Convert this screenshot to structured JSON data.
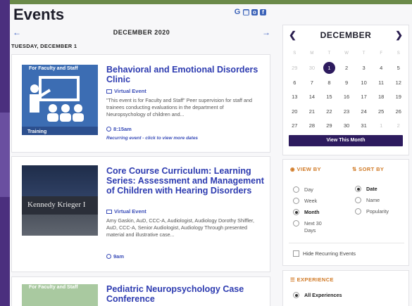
{
  "page": {
    "title": "Events",
    "share_icons": [
      "G",
      "cal",
      "o",
      "f"
    ]
  },
  "month_nav": {
    "prev": "←",
    "label": "DECEMBER 2020",
    "next": "→"
  },
  "day_label": "TUESDAY, DECEMBER 1",
  "events": [
    {
      "title": "Behavioral and Emotional Disorders Clinic",
      "type": "Virtual Event",
      "description": "\"This event is for Faculty and Staff\" Peer supervision for staff and trainees conducting evaluations in the department of Neuropsychology of children and...",
      "time": "8:15am",
      "recurring": "Recurring event - click to view more dates",
      "thumb_top": "For Faculty and Staff",
      "thumb_bottom": "Training"
    },
    {
      "title": "Core Course Curriculum: Learning Series: Assessment and Management of Children with Hearing Disorders",
      "type": "Virtual Event",
      "description": "Amy Gaskin, AuD, CCC-A, Audiologist, Audiology Dorothy Shiffler, AuD, CCC-A, Senior Audiologist, Audiology Through presented material and illustrative case...",
      "time": "9am",
      "thumb_sign": "Kennedy Krieger I"
    },
    {
      "title": "Pediatric Neuropsychology Case Conference",
      "thumb_top": "For Faculty and Staff"
    }
  ],
  "calendar": {
    "prev": "❮",
    "month": "DECEMBER",
    "next": "❯",
    "dow": [
      "S",
      "M",
      "T",
      "W",
      "T",
      "F",
      "S"
    ],
    "weeks": [
      [
        "29",
        "30",
        "1",
        "2",
        "3",
        "4",
        "5"
      ],
      [
        "6",
        "7",
        "8",
        "9",
        "10",
        "11",
        "12"
      ],
      [
        "13",
        "14",
        "15",
        "16",
        "17",
        "18",
        "19"
      ],
      [
        "20",
        "21",
        "22",
        "23",
        "24",
        "25",
        "26"
      ],
      [
        "27",
        "28",
        "29",
        "30",
        "31",
        "1",
        "2"
      ]
    ],
    "selected_day": "1",
    "view_month_button": "View This Month"
  },
  "view_by": {
    "view_heading": "VIEW BY",
    "sort_heading": "SORT BY",
    "view_options": [
      "Day",
      "Week",
      "Month",
      "Next 30 Days"
    ],
    "view_selected": "Month",
    "sort_options": [
      "Date",
      "Name",
      "Popularity"
    ],
    "sort_selected": "Date",
    "hide_recurring": "Hide Recurring Events"
  },
  "experience": {
    "heading": "EXPERIENCE",
    "selected": "All Experiences"
  }
}
